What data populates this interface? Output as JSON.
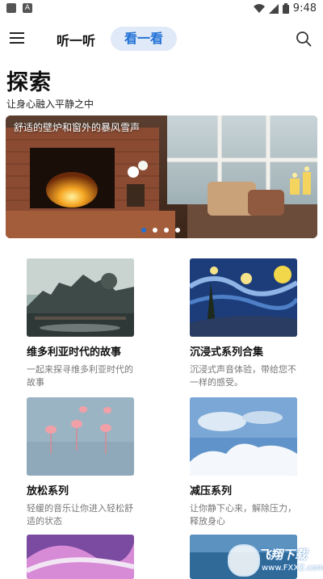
{
  "status_bar": {
    "time": "9:48",
    "left_icons": [
      "notification-icon",
      "app-icon"
    ],
    "right_icons": [
      "wifi-icon",
      "signal-icon",
      "battery-icon"
    ]
  },
  "nav": {
    "tab_listen": "听一听",
    "tab_watch": "看一看",
    "active_tab": "看一看"
  },
  "header": {
    "title": "探索",
    "subtitle": "让身心融入平静之中"
  },
  "banner": {
    "caption": "舒适的壁炉和窗外的暴风雪声",
    "dots": 4,
    "active_dot": 1
  },
  "cards": [
    {
      "title": "维多利亚时代的故事",
      "desc": "一起来探寻维多利亚时代的故事"
    },
    {
      "title": "沉浸式系列合集",
      "desc": "沉浸式声音体验，带给您不一样的感受。"
    },
    {
      "title": "放松系列",
      "desc": "轻缓的音乐让你进入轻松舒适的状态"
    },
    {
      "title": "减压系列",
      "desc": "让你静下心来，解除压力，释放身心"
    }
  ],
  "watermark": {
    "title": "飞翔下载",
    "url": "www.FXXZ.com"
  },
  "colors": {
    "accent": "#1f6fd6",
    "tab_bg": "#dfe9f7"
  }
}
